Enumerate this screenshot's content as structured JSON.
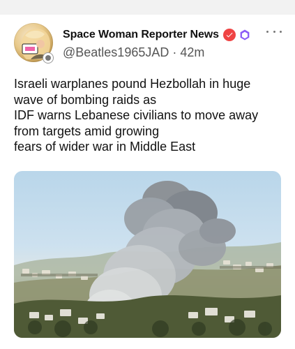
{
  "post": {
    "author": {
      "display_name": "Space Woman Reporter News",
      "handle": "@Beatles1965JAD",
      "time_ago": "42m",
      "separator": "·"
    },
    "icons": {
      "verified": "verified-check-icon",
      "badge": "hexagon-badge-icon",
      "more": "more-options-icon"
    },
    "text": "Israeli warplanes pound Hezbollah in huge\nwave of bombing raids as\nIDF warns Lebanese civilians to move away\nfrom targets amid growing\nfears of wider war in Middle East",
    "colors": {
      "verified": "#ef4444",
      "badge": "#8b5cf6",
      "text": "#111111",
      "muted": "#555555"
    }
  }
}
